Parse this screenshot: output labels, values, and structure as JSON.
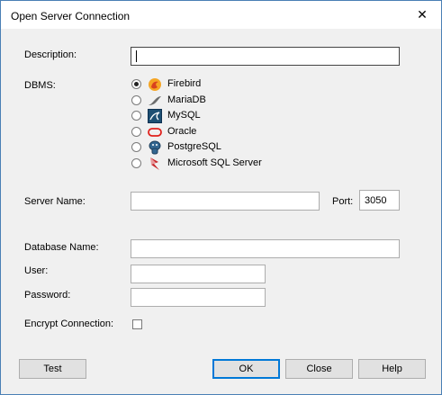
{
  "window": {
    "title": "Open Server Connection",
    "close_glyph": "✕"
  },
  "form": {
    "description": {
      "label": "Description:",
      "value": ""
    },
    "dbms": {
      "label": "DBMS:",
      "options": [
        {
          "label": "Firebird",
          "icon": "firebird-icon",
          "checked": true
        },
        {
          "label": "MariaDB",
          "icon": "mariadb-icon",
          "checked": false
        },
        {
          "label": "MySQL",
          "icon": "mysql-icon",
          "checked": false
        },
        {
          "label": "Oracle",
          "icon": "oracle-icon",
          "checked": false
        },
        {
          "label": "PostgreSQL",
          "icon": "postgresql-icon",
          "checked": false
        },
        {
          "label": "Microsoft SQL Server",
          "icon": "sqlserver-icon",
          "checked": false
        }
      ]
    },
    "server_name": {
      "label": "Server Name:",
      "value": ""
    },
    "port": {
      "label": "Port:",
      "value": "3050"
    },
    "database_name": {
      "label": "Database Name:",
      "value": ""
    },
    "user": {
      "label": "User:",
      "value": ""
    },
    "password": {
      "label": "Password:",
      "value": ""
    },
    "encrypt": {
      "label": "Encrypt Connection:",
      "checked": false
    }
  },
  "buttons": {
    "test": "Test",
    "ok": "OK",
    "close": "Close",
    "help": "Help"
  },
  "colors": {
    "border": "#4a7fb5",
    "default_button": "#0078d7",
    "dialog_bg": "#f0f0f0"
  }
}
